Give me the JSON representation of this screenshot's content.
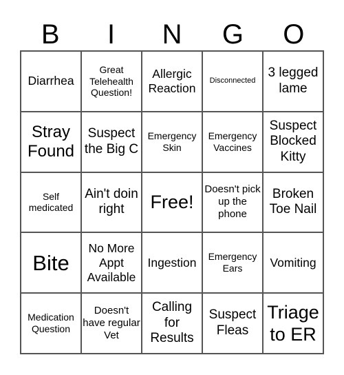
{
  "header": [
    "B",
    "I",
    "N",
    "G",
    "O"
  ],
  "cells": [
    {
      "text": "Diarrhea",
      "size": "s17"
    },
    {
      "text": "Great Telehealth Question!",
      "size": "s14"
    },
    {
      "text": "Allergic Reaction",
      "size": "s17"
    },
    {
      "text": "Disconnected",
      "size": "s11"
    },
    {
      "text": "3 legged lame",
      "size": "s19"
    },
    {
      "text": "Stray Found",
      "size": "s22"
    },
    {
      "text": "Suspect the Big C",
      "size": "s19"
    },
    {
      "text": "Emergency Skin",
      "size": "s14"
    },
    {
      "text": "Emergency Vaccines",
      "size": "s14"
    },
    {
      "text": "Suspect Blocked Kitty",
      "size": "s19"
    },
    {
      "text": "Self medicated",
      "size": "s14"
    },
    {
      "text": "Ain't doin right",
      "size": "s19"
    },
    {
      "text": "Free!",
      "size": "s25"
    },
    {
      "text": "Doesn't pick up the phone",
      "size": "s15"
    },
    {
      "text": "Broken Toe Nail",
      "size": "s19"
    },
    {
      "text": "Bite",
      "size": "s30"
    },
    {
      "text": "No More Appt Available",
      "size": "s17"
    },
    {
      "text": "Ingestion",
      "size": "s17"
    },
    {
      "text": "Emergency Ears",
      "size": "s14"
    },
    {
      "text": "Vomiting",
      "size": "s17"
    },
    {
      "text": "Medication Question",
      "size": "s14"
    },
    {
      "text": "Doesn't have regular Vet",
      "size": "s15"
    },
    {
      "text": "Calling for Results",
      "size": "s19"
    },
    {
      "text": "Suspect Fleas",
      "size": "s19"
    },
    {
      "text": "Triage to ER",
      "size": "s25"
    }
  ]
}
